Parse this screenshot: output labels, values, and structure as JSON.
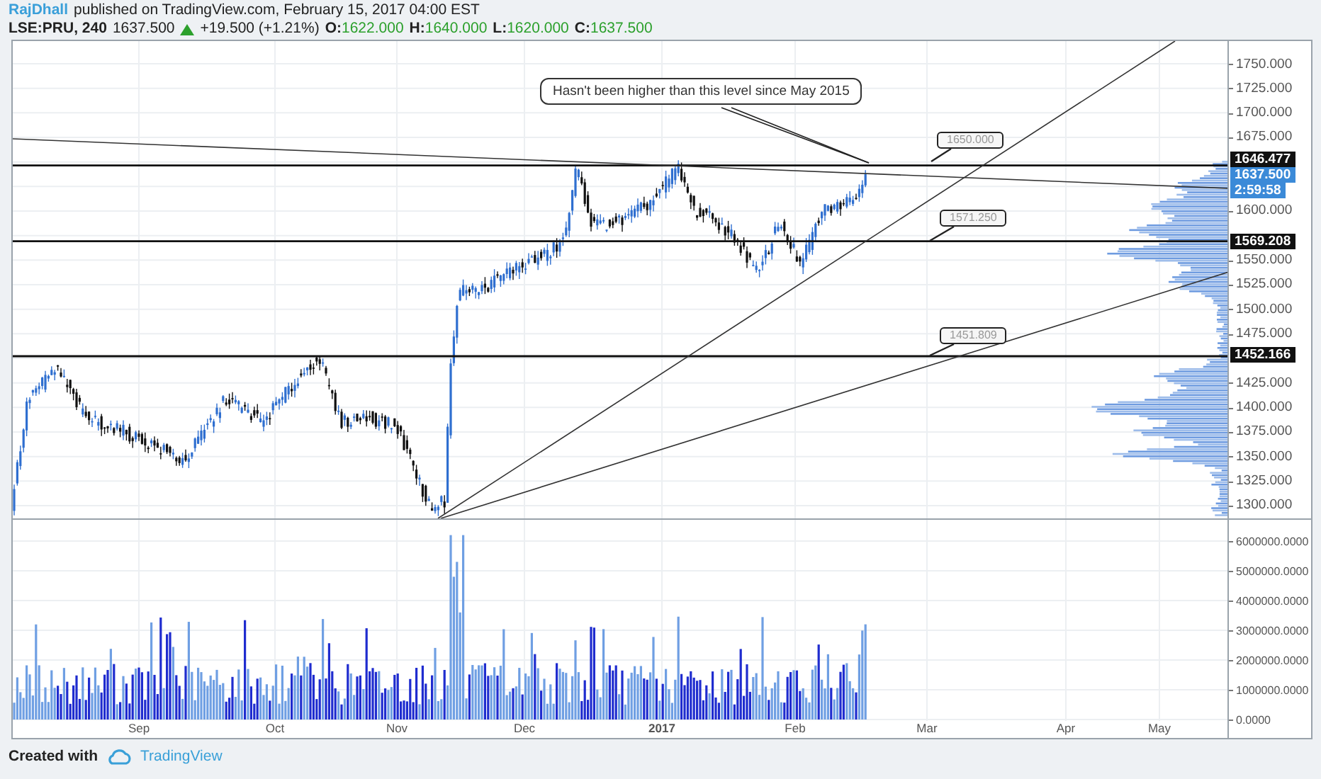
{
  "header": {
    "author": "RajDhall",
    "published": "published on TradingView.com, February 15, 2017 04:00 EST"
  },
  "symbol_bar": {
    "symbol": "LSE:PRU, 240",
    "last": "1637.500",
    "up": true,
    "change": "+19.500 (+1.21%)",
    "ohlc": [
      {
        "label": "O:",
        "value": "1622.000"
      },
      {
        "label": "H:",
        "value": "1640.000"
      },
      {
        "label": "L:",
        "value": "1620.000"
      },
      {
        "label": "C:",
        "value": "1637.500"
      }
    ]
  },
  "annotations": [
    {
      "kind": "note",
      "text": "Hasn't been higher than this level since May 2015"
    },
    {
      "kind": "price_label",
      "text": "1650.000"
    },
    {
      "kind": "price_label",
      "text": "1571.250"
    },
    {
      "kind": "price_label",
      "text": "1451.809"
    }
  ],
  "price_axis": {
    "ticks": [
      "1750.000",
      "1725.000",
      "1700.000",
      "1675.000",
      "1600.000",
      "1550.000",
      "1525.000",
      "1500.000",
      "1475.000",
      "1425.000",
      "1400.000",
      "1375.000",
      "1350.000",
      "1325.000",
      "1300.000"
    ],
    "tags": [
      {
        "kind": "level",
        "text": "1646.477"
      },
      {
        "kind": "price",
        "text": "1637.500"
      },
      {
        "kind": "countdown",
        "text": "2:59:58"
      },
      {
        "kind": "level",
        "text": "1569.208"
      },
      {
        "kind": "level",
        "text": "1452.166"
      }
    ]
  },
  "volume_axis": {
    "ticks": [
      "6000000.0000",
      "5000000.0000",
      "4000000.0000",
      "3000000.0000",
      "2000000.0000",
      "1000000.0000",
      "0.0000"
    ]
  },
  "time_axis": {
    "ticks": [
      {
        "label": "Sep",
        "emphasis": false
      },
      {
        "label": "Oct",
        "emphasis": false
      },
      {
        "label": "Nov",
        "emphasis": false
      },
      {
        "label": "Dec",
        "emphasis": false
      },
      {
        "label": "2017",
        "emphasis": true
      },
      {
        "label": "Feb",
        "emphasis": false
      },
      {
        "label": "Mar",
        "emphasis": false
      },
      {
        "label": "Apr",
        "emphasis": false
      },
      {
        "label": "May",
        "emphasis": false
      }
    ]
  },
  "footer": {
    "created": "Created with",
    "brand": "TradingView"
  }
}
